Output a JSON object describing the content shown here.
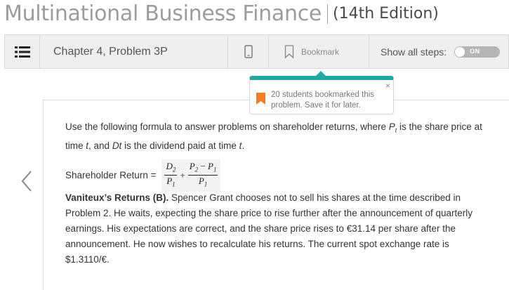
{
  "book": {
    "title": "Multinational Business Finance",
    "edition": "(14th Edition)"
  },
  "toolbar": {
    "menu_icon": "list-icon",
    "chapter": "Chapter 4, Problem 3P",
    "phone_icon": "smartphone-icon",
    "bookmark_icon": "bookmark-icon",
    "bookmark_label": "Bookmark",
    "steps_label": "Show all steps:",
    "toggle_label": "ON"
  },
  "popup": {
    "message": "20 students bookmarked this problem. Save it for later.",
    "close_label": "×",
    "accent_color": "#23a8a1",
    "flag_color": "#f57c22"
  },
  "nav": {
    "prev_icon": "chevron-left-icon"
  },
  "problem": {
    "intro_1": "Use the following formula to answer problems on shareholder returns, where ",
    "intro_p": "P",
    "intro_psub": "t",
    "intro_2": " is the share price at time ",
    "intro_t1": "t",
    "intro_3": ", and ",
    "intro_dt": "Dt",
    "intro_4": " is the dividend paid at time ",
    "intro_t2": "t",
    "intro_5": ".",
    "formula_label": "Shareholder Return =",
    "formula": {
      "d": "D",
      "d_sub": "2",
      "p1": "P",
      "p1_sub": "1",
      "plus": "+",
      "p2": "P",
      "p2_sub": "2",
      "minus": " − ",
      "p3": "P",
      "p3_sub": "1",
      "p4": "P",
      "p4_sub": "1"
    },
    "heading": "Vaniteux’s Returns (B).",
    "body": " Spencer Grant chooses not to sell his shares at the time described in Problem 2. He waits, expecting the share price to rise further after the announcement of quarterly earnings. His expectations are correct, and the share price rises to €31.14 per share after the announcement. He now wishes to recalculate his returns. The current spot exchange rate is $1.3110/€."
  }
}
